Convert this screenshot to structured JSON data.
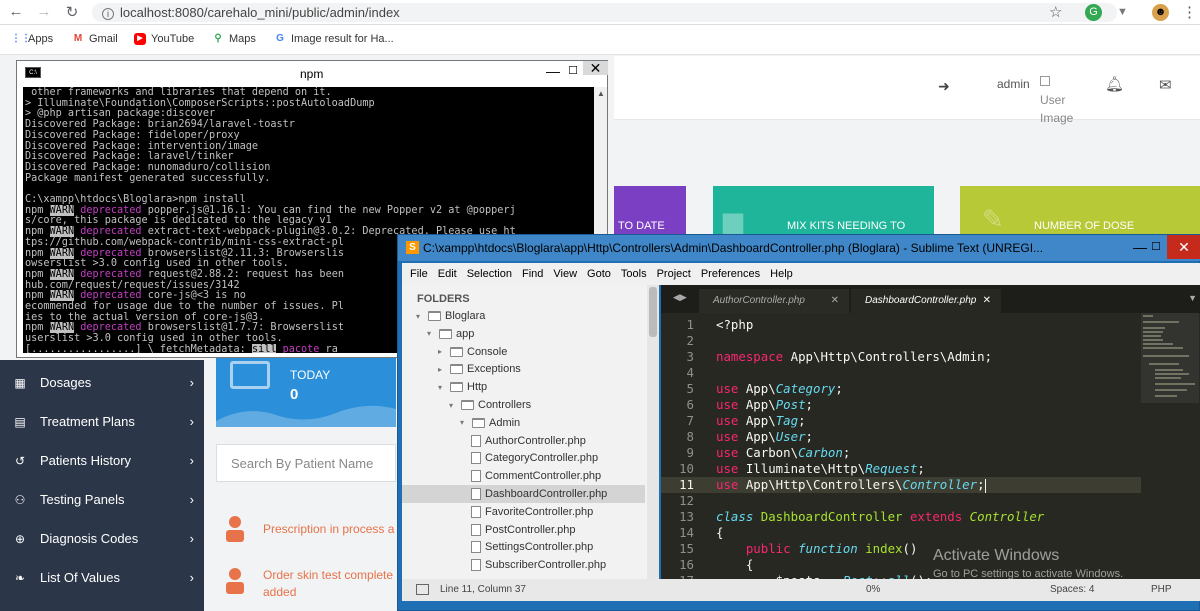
{
  "browser": {
    "url": "localhost:8080/carehalo_mini/public/admin/index",
    "bookmarks": [
      {
        "label": "Apps",
        "icon": "apps-grid-icon",
        "color": "#4285f4"
      },
      {
        "label": "Gmail",
        "icon": "gmail-icon",
        "color": "#ea4335"
      },
      {
        "label": "YouTube",
        "icon": "youtube-icon",
        "color": "#ff0000"
      },
      {
        "label": "Maps",
        "icon": "maps-pin-icon",
        "color": "#34a853"
      },
      {
        "label": "Image result for Ha...",
        "icon": "google-g-icon",
        "color": "#4285f4"
      }
    ]
  },
  "admin": {
    "user_name": "admin",
    "avatar_alt_1": "User",
    "avatar_alt_2": "Image",
    "cards": [
      {
        "label": "TO DATE",
        "color": "#7b3fc4"
      },
      {
        "label": "MIX KITS NEEDING TO",
        "color": "#1fb59a"
      },
      {
        "label": "NUMBER OF DOSE",
        "color": "#b7c937"
      }
    ],
    "today": {
      "label": "TODAY",
      "value": "0"
    },
    "search_placeholder": "Search By Patient Name",
    "sidebar": [
      {
        "label": "Dosages",
        "icon": "calendar-icon"
      },
      {
        "label": "Treatment Plans",
        "icon": "file-icon"
      },
      {
        "label": "Patients History",
        "icon": "history-icon"
      },
      {
        "label": "Testing Panels",
        "icon": "users-icon"
      },
      {
        "label": "Diagnosis Codes",
        "icon": "plus-circle-icon"
      },
      {
        "label": "List Of Values",
        "icon": "leaf-icon"
      }
    ],
    "feed": [
      {
        "text": "Prescription in process a"
      },
      {
        "text": "Order skin test complete",
        "text2": "added"
      }
    ],
    "accent_orange": "#e8734a",
    "sidebar_bg": "#2b3648"
  },
  "npm_window": {
    "title": "npm",
    "lines": [
      [
        {
          "t": " other frameworks and libraries that depend on it."
        }
      ],
      [
        {
          "t": "> Illuminate\\Foundation\\ComposerScripts::postAutoloadDump"
        }
      ],
      [
        {
          "t": "> @php artisan package:discover"
        }
      ],
      [
        {
          "t": "Discovered Package: brian2694/laravel-toastr"
        }
      ],
      [
        {
          "t": "Discovered Package: fideloper/proxy"
        }
      ],
      [
        {
          "t": "Discovered Package: intervention/image"
        }
      ],
      [
        {
          "t": "Discovered Package: laravel/tinker"
        }
      ],
      [
        {
          "t": "Discovered Package: nunomaduro/collision"
        }
      ],
      [
        {
          "t": "Package manifest generated successfully."
        }
      ],
      [
        {
          "t": ""
        }
      ],
      [
        {
          "t": "C:\\xampp\\htdocs\\Bloglara>npm install"
        }
      ],
      [
        {
          "t": "npm "
        },
        {
          "t": "WARN",
          "c": "warn"
        },
        {
          "t": " deprecated",
          "c": "depr"
        },
        {
          "t": " popper.js@1.16.1: You can find the new Popper v2 at @popperj"
        }
      ],
      [
        {
          "t": "s/core, this package is dedicated to the legacy v1"
        }
      ],
      [
        {
          "t": "npm "
        },
        {
          "t": "WARN",
          "c": "warn"
        },
        {
          "t": " deprecated",
          "c": "depr"
        },
        {
          "t": " extract-text-webpack-plugin@3.0.2: Deprecated. Please use ht"
        }
      ],
      [
        {
          "t": "tps://github.com/webpack-contrib/mini-css-extract-pl"
        }
      ],
      [
        {
          "t": "npm "
        },
        {
          "t": "WARN",
          "c": "warn"
        },
        {
          "t": " deprecated",
          "c": "depr"
        },
        {
          "t": " browserslist@2.11.3: Browserslis"
        }
      ],
      [
        {
          "t": "owserslist >3.0 config used in other tools."
        }
      ],
      [
        {
          "t": "npm "
        },
        {
          "t": "WARN",
          "c": "warn"
        },
        {
          "t": " deprecated",
          "c": "depr"
        },
        {
          "t": " request@2.88.2: request has been"
        }
      ],
      [
        {
          "t": "hub.com/request/request/issues/3142"
        }
      ],
      [
        {
          "t": "npm "
        },
        {
          "t": "WARN",
          "c": "warn"
        },
        {
          "t": " deprecated",
          "c": "depr"
        },
        {
          "t": " core-js@<3 is no"
        }
      ],
      [
        {
          "t": "ecommended for usage due to the number of issues. Pl"
        }
      ],
      [
        {
          "t": "ies to the actual version of core-js@3."
        }
      ],
      [
        {
          "t": "npm "
        },
        {
          "t": "WARN",
          "c": "warn"
        },
        {
          "t": " deprecated",
          "c": "depr"
        },
        {
          "t": " browserslist@1.7.7: Browserslist"
        }
      ],
      [
        {
          "t": "userslist >3.0 config used in other tools."
        }
      ],
      [
        {
          "t": "[.................] \\ fetchMetadata: "
        },
        {
          "t": "sill",
          "c": "warn"
        },
        {
          "t": " pacote",
          "c": "depr"
        },
        {
          "t": " ra"
        }
      ]
    ]
  },
  "sublime": {
    "title": "C:\\xampp\\htdocs\\Bloglara\\app\\Http\\Controllers\\Admin\\DashboardController.php (Bloglara) - Sublime Text (UNREGI...",
    "menu": [
      "File",
      "Edit",
      "Selection",
      "Find",
      "View",
      "Goto",
      "Tools",
      "Project",
      "Preferences",
      "Help"
    ],
    "folders_header": "FOLDERS",
    "tree": [
      {
        "label": "Bloglara",
        "type": "folder",
        "depth": 0,
        "open": true
      },
      {
        "label": "app",
        "type": "folder",
        "depth": 1,
        "open": true
      },
      {
        "label": "Console",
        "type": "folder",
        "depth": 2,
        "open": false
      },
      {
        "label": "Exceptions",
        "type": "folder",
        "depth": 2,
        "open": false
      },
      {
        "label": "Http",
        "type": "folder",
        "depth": 2,
        "open": true
      },
      {
        "label": "Controllers",
        "type": "folder",
        "depth": 3,
        "open": true
      },
      {
        "label": "Admin",
        "type": "folder",
        "depth": 4,
        "open": true
      },
      {
        "label": "AuthorController.php",
        "type": "file",
        "depth": 5
      },
      {
        "label": "CategoryController.php",
        "type": "file",
        "depth": 5
      },
      {
        "label": "CommentController.php",
        "type": "file",
        "depth": 5
      },
      {
        "label": "DashboardController.php",
        "type": "file",
        "depth": 5,
        "selected": true
      },
      {
        "label": "FavoriteController.php",
        "type": "file",
        "depth": 5
      },
      {
        "label": "PostController.php",
        "type": "file",
        "depth": 5
      },
      {
        "label": "SettingsController.php",
        "type": "file",
        "depth": 5
      },
      {
        "label": "SubscriberController.php",
        "type": "file",
        "depth": 5
      }
    ],
    "tabs": [
      {
        "label": "AuthorController.php",
        "active": false
      },
      {
        "label": "DashboardController.php",
        "active": true
      }
    ],
    "code": [
      {
        "n": "1",
        "s": [
          {
            "t": "<?php"
          }
        ]
      },
      {
        "n": "2",
        "s": []
      },
      {
        "n": "3",
        "s": [
          {
            "t": "namespace ",
            "c": "kw"
          },
          {
            "t": "App\\Http\\Controllers\\Admin;"
          }
        ]
      },
      {
        "n": "4",
        "s": []
      },
      {
        "n": "5",
        "s": [
          {
            "t": "use ",
            "c": "kw"
          },
          {
            "t": "App\\"
          },
          {
            "t": "Category",
            "c": "fn"
          },
          {
            "t": ";"
          }
        ]
      },
      {
        "n": "6",
        "s": [
          {
            "t": "use ",
            "c": "kw"
          },
          {
            "t": "App\\"
          },
          {
            "t": "Post",
            "c": "fn"
          },
          {
            "t": ";"
          }
        ]
      },
      {
        "n": "7",
        "s": [
          {
            "t": "use ",
            "c": "kw"
          },
          {
            "t": "App\\"
          },
          {
            "t": "Tag",
            "c": "fn"
          },
          {
            "t": ";"
          }
        ]
      },
      {
        "n": "8",
        "s": [
          {
            "t": "use ",
            "c": "kw"
          },
          {
            "t": "App\\"
          },
          {
            "t": "User",
            "c": "fn"
          },
          {
            "t": ";"
          }
        ]
      },
      {
        "n": "9",
        "s": [
          {
            "t": "use ",
            "c": "kw"
          },
          {
            "t": "Carbon\\"
          },
          {
            "t": "Carbon",
            "c": "fn"
          },
          {
            "t": ";"
          }
        ]
      },
      {
        "n": "10",
        "s": [
          {
            "t": "use ",
            "c": "kw"
          },
          {
            "t": "Illuminate\\Http\\"
          },
          {
            "t": "Request",
            "c": "fn"
          },
          {
            "t": ";"
          }
        ]
      },
      {
        "n": "11",
        "s": [
          {
            "t": "use ",
            "c": "kw"
          },
          {
            "t": "App\\Http\\Controllers\\"
          },
          {
            "t": "Controller",
            "c": "fn"
          },
          {
            "t": ";"
          }
        ],
        "current": true
      },
      {
        "n": "12",
        "s": []
      },
      {
        "n": "13",
        "s": [
          {
            "t": "class ",
            "c": "fn"
          },
          {
            "t": "DashboardController ",
            "c": "def"
          },
          {
            "t": "extends ",
            "c": "kw"
          },
          {
            "t": "Controller",
            "c": "cls"
          }
        ]
      },
      {
        "n": "14",
        "s": [
          {
            "t": "{"
          }
        ]
      },
      {
        "n": "15",
        "s": [
          {
            "t": "    "
          },
          {
            "t": "public ",
            "c": "kw"
          },
          {
            "t": "function ",
            "c": "fn"
          },
          {
            "t": "index",
            "c": "def"
          },
          {
            "t": "()"
          }
        ]
      },
      {
        "n": "16",
        "s": [
          {
            "t": "    {"
          }
        ]
      },
      {
        "n": "17",
        "s": [
          {
            "t": "        $posts = "
          },
          {
            "t": "Post",
            "c": "fn"
          },
          {
            "t": "::"
          },
          {
            "t": "all",
            "c": "fn"
          },
          {
            "t": "();"
          }
        ]
      }
    ],
    "status_position": "Line 11, Column 37",
    "status_spaces": "Spaces: 4",
    "status_syntax": "PHP",
    "status_percent": "0%",
    "activate_title": "Activate Windows",
    "activate_sub": "Go to PC settings to activate Windows."
  }
}
